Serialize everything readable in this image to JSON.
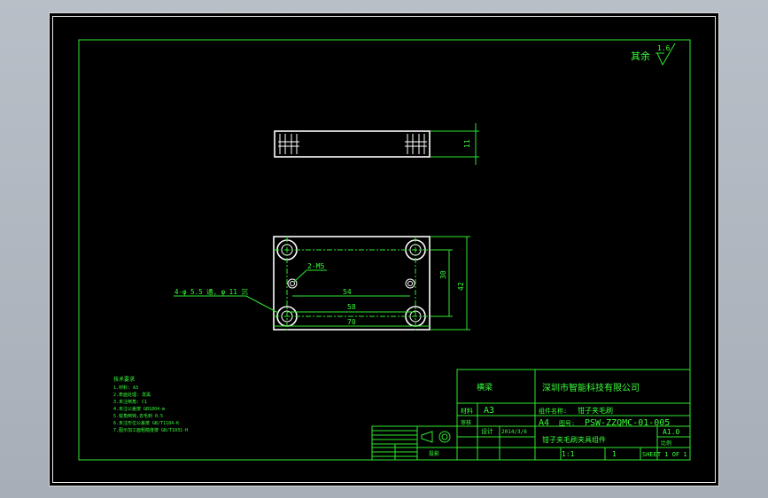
{
  "surface_finish": {
    "label": "其余",
    "value": "1.6"
  },
  "side_view": {
    "dim_height": "11"
  },
  "top_view": {
    "hole_note": "4-φ 5.5 通, φ 11 沉",
    "thread_note": "2-M5",
    "dim_54": "54",
    "dim_58": "58",
    "dim_70": "70",
    "dim_30": "30",
    "dim_42": "42"
  },
  "tech_notes": [
    "技术要求",
    "1.材料: A3",
    "2.表面处理: 发黑",
    "3.未注倒角: C1",
    "4.未注公差按 GB1804-m",
    "5.锐角倒钝,去毛刺 0.5",
    "6.未注形位公差按 GB/T1184-K",
    "7.图示加工面粗糙度按 GB/T1031-H"
  ],
  "title_block": {
    "company": "深圳市智能科技有限公司",
    "drawing_title": "横梁",
    "material_label": "材料",
    "material_value": "A3",
    "check_label": "审核",
    "part_label": "组件名称:",
    "part_value": "钳子夹毛刷",
    "size_label": "A4",
    "drawing_no_label": "图号:",
    "drawing_no": "PSW-ZZQMC-01-005",
    "version": "A1.0",
    "assembly_name": "钳子夹毛刷夹具组件",
    "scale_label": "比例",
    "scale_value": "1:1",
    "qty_value": "1",
    "sheet": "SHEET 1 OF 1",
    "date": "2014/3/6",
    "signature_label": "设计",
    "projection_label": "投影"
  },
  "colors": {
    "background": "#000000",
    "frame": "#2ee82e",
    "geometry": "#ffffff",
    "window": "#b0b6bf"
  }
}
